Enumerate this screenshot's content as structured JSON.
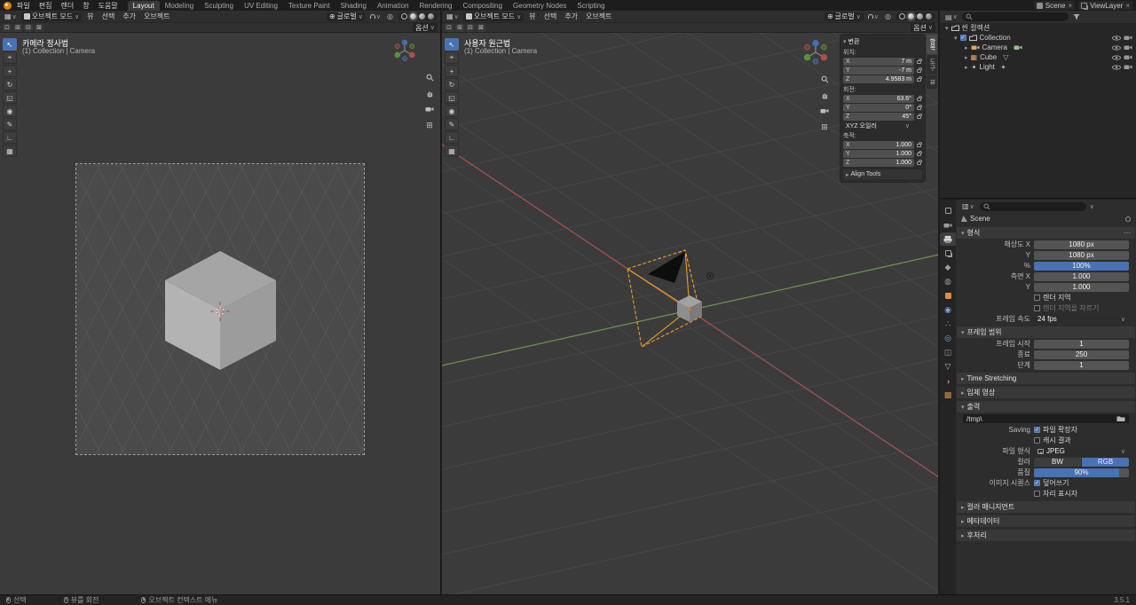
{
  "topbar": {
    "menus": [
      "파일",
      "편집",
      "렌더",
      "창",
      "도움말"
    ],
    "workspaces": [
      "Layout",
      "Modeling",
      "Sculpting",
      "UV Editing",
      "Texture Paint",
      "Shading",
      "Animation",
      "Rendering",
      "Compositing",
      "Geometry Nodes",
      "Scripting"
    ],
    "scene_label": "Scene",
    "viewlayer_label": "ViewLayer"
  },
  "viewport_left": {
    "mode": "오브젝트 모드",
    "menu_view": "뷰",
    "menu_select": "선택",
    "menu_add": "추가",
    "menu_object": "오브젝트",
    "orientation": "글로벌",
    "options_label": "옵션",
    "view_label": "카메라 정사법",
    "breadcrumb": "(1) Collection | Camera"
  },
  "viewport_right": {
    "mode": "오브젝트 모드",
    "menu_view": "뷰",
    "menu_select": "선택",
    "menu_add": "추가",
    "menu_object": "오브젝트",
    "orientation": "글로벌",
    "options_label": "옵션",
    "view_label": "사용자 원근법",
    "breadcrumb": "(1) Collection | Camera"
  },
  "sidebar": {
    "tabs": [
      "항목",
      "도구",
      "뷰"
    ],
    "transform_title": "변환",
    "location_label": "위치:",
    "location": [
      {
        "axis": "X",
        "value": "7 m"
      },
      {
        "axis": "Y",
        "value": "-7 m"
      },
      {
        "axis": "Z",
        "value": "4.9583 m"
      }
    ],
    "rotation_label": "회전:",
    "rotation": [
      {
        "axis": "X",
        "value": "63.6°"
      },
      {
        "axis": "Y",
        "value": "0°"
      },
      {
        "axis": "Z",
        "value": "45°"
      }
    ],
    "rotation_mode": "XYZ 오일러",
    "scale_label": "축적:",
    "scale": [
      {
        "axis": "X",
        "value": "1.000"
      },
      {
        "axis": "Y",
        "value": "1.000"
      },
      {
        "axis": "Z",
        "value": "1.000"
      }
    ],
    "align_tools_label": "Align Tools"
  },
  "outliner": {
    "root_label": "씬 컬렉션",
    "collection_label": "Collection",
    "objects": [
      {
        "name": "Camera"
      },
      {
        "name": "Cube"
      },
      {
        "name": "Light"
      }
    ]
  },
  "properties": {
    "id_label": "Scene",
    "format": {
      "title": "형식",
      "resolution_x_label": "해상도 X",
      "resolution_x": "1080 px",
      "resolution_y_label": "Y",
      "resolution_y": "1080 px",
      "percent_label": "%",
      "percent": "100%",
      "aspect_x_label": "측면 X",
      "aspect_x": "1.000",
      "aspect_y_label": "Y",
      "aspect_y": "1.000",
      "render_region_label": "렌더 지역",
      "crop_label": "렌더 지역을 자르기",
      "frame_rate_label": "프레임 속도",
      "frame_rate": "24 fps"
    },
    "frame_range": {
      "title": "프레임 범위",
      "start_label": "프레임 시작",
      "start": "1",
      "end_label": "종료",
      "end": "250",
      "step_label": "단계",
      "step": "1"
    },
    "time_stretching_title": "Time Stretching",
    "stereoscopy_title": "입체 영상",
    "output": {
      "title": "출력",
      "path": "/tmp\\",
      "saving_label": "Saving",
      "file_extensions_label": "파일 확장자",
      "cache_result_label": "캐시 결과",
      "file_format_label": "파일 형식",
      "file_format": "JPEG",
      "color_label": "컬러",
      "color_bw": "BW",
      "color_rgb": "RGB",
      "quality_label": "품질",
      "quality": "90%",
      "image_sequence_label": "이미지 시퀀스",
      "overwrite_label": "덮어쓰기",
      "placeholders_label": "자리 표시자"
    },
    "color_management_title": "컬러 매니지먼트",
    "metadata_title": "메타데이터",
    "post_processing_title": "후처리"
  },
  "statusbar": {
    "select": "선택",
    "rotate_view": "뷰를 회전",
    "context_menu": "오브젝트 컨텍스트 메뉴",
    "version": "3.5.1"
  },
  "colors": {
    "accent": "#4772b3",
    "selected_outline": "#e5a024",
    "axis_x": "#a05252",
    "axis_y": "#6d8f4e"
  }
}
